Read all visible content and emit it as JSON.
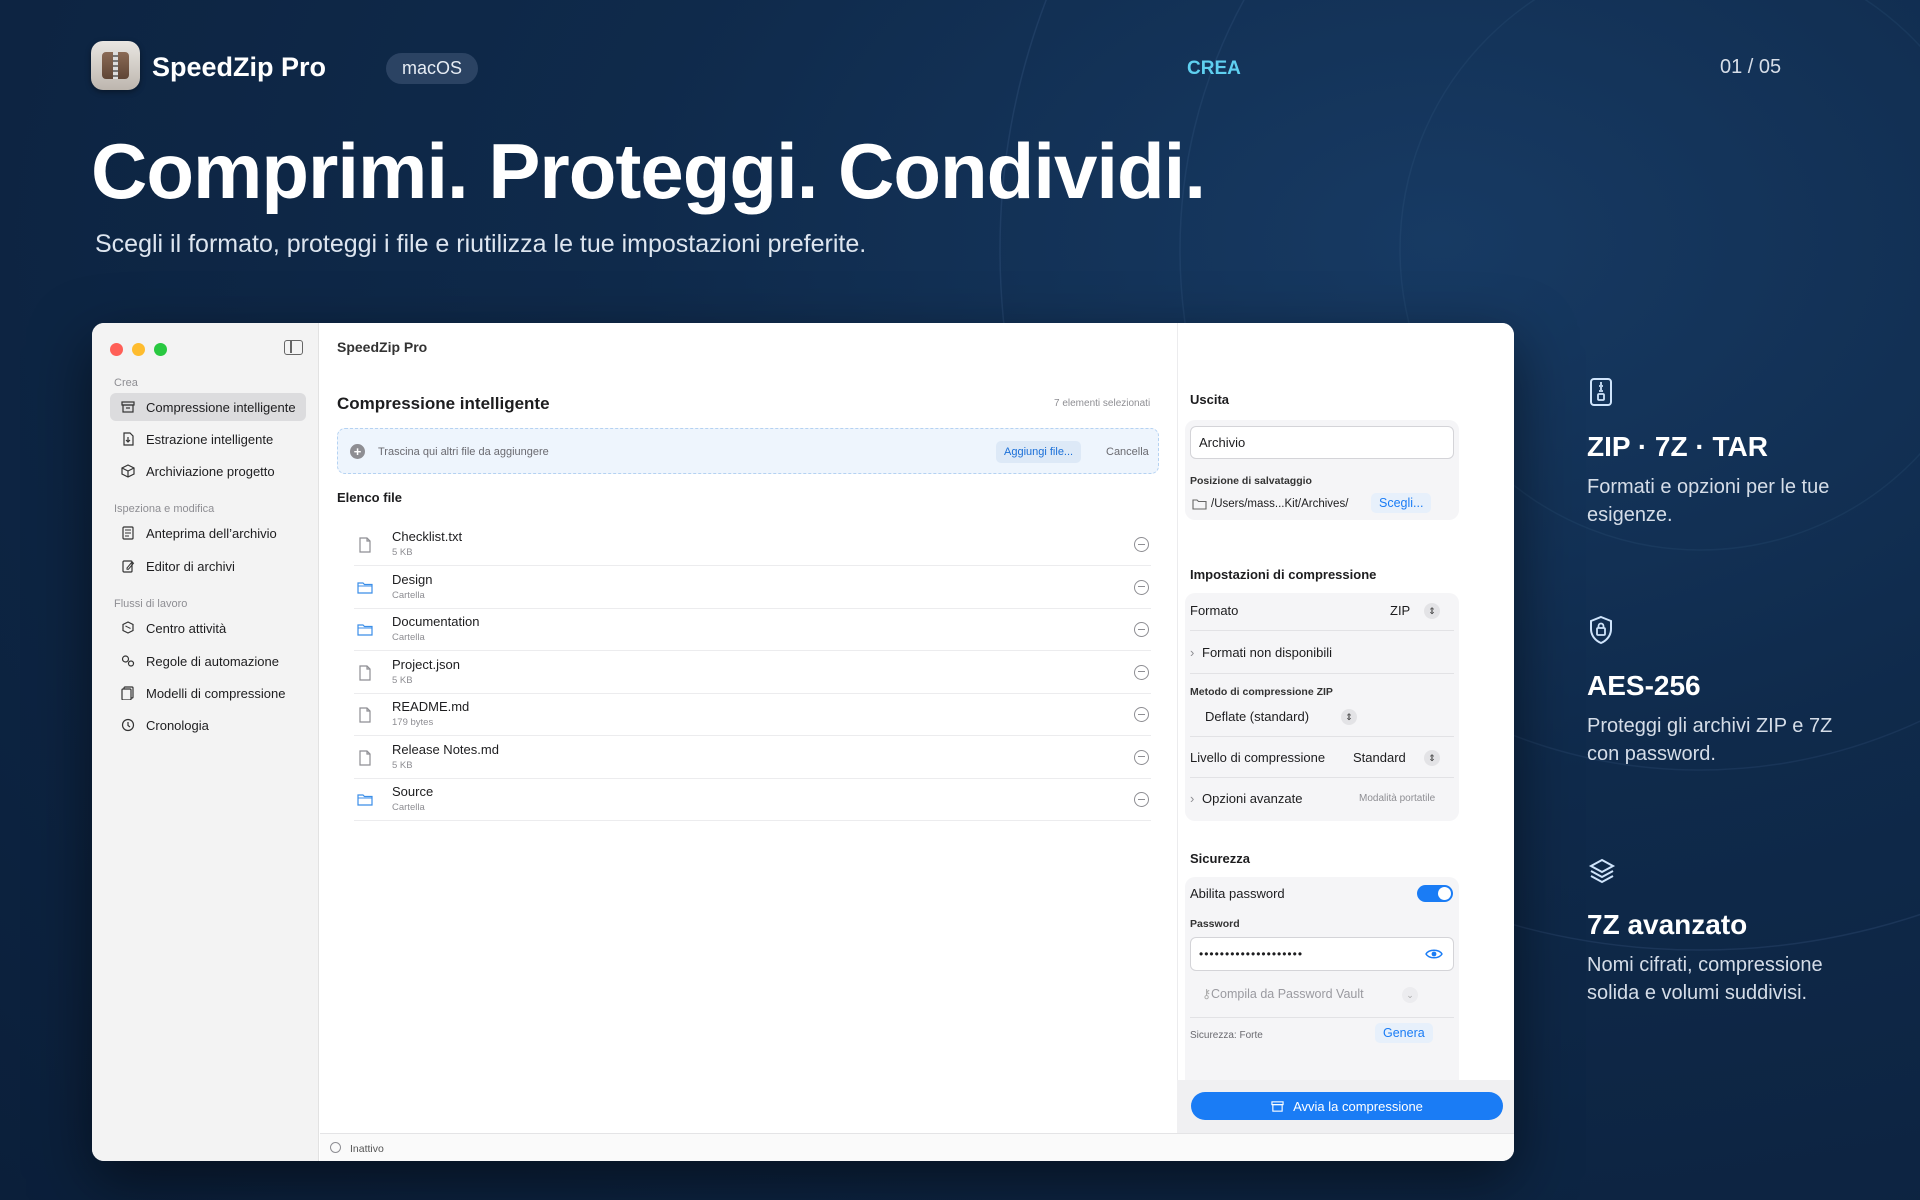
{
  "header": {
    "app_name": "SpeedZip Pro",
    "platform": "macOS",
    "section": "CREA",
    "page": "01 / 05",
    "headline": "Comprimi. Proteggi. Condividi.",
    "subline": "Scegli il formato, proteggi i file e riutilizza le tue impostazioni preferite."
  },
  "window": {
    "title": "SpeedZip Pro",
    "sidebar": {
      "group_create": "Crea",
      "group_inspect": "Ispeziona e modifica",
      "group_workflows": "Flussi di lavoro",
      "items": [
        {
          "label": "Compressione intelligente",
          "icon": "archive-icon"
        },
        {
          "label": "Estrazione intelligente",
          "icon": "extract-icon"
        },
        {
          "label": "Archiviazione progetto",
          "icon": "package-icon"
        },
        {
          "label": "Anteprima dell’archivio",
          "icon": "preview-icon"
        },
        {
          "label": "Editor di archivi",
          "icon": "edit-icon"
        },
        {
          "label": "Centro attività",
          "icon": "activity-icon"
        },
        {
          "label": "Regole di automazione",
          "icon": "automation-icon"
        },
        {
          "label": "Modelli di compressione",
          "icon": "template-icon"
        },
        {
          "label": "Cronologia",
          "icon": "clock-icon"
        }
      ]
    },
    "main": {
      "title": "Compressione intelligente",
      "selected_count": "7 elementi selezionati",
      "dropzone_text": "Trascina qui altri file da aggiungere",
      "add_files": "Aggiungi file...",
      "cancel": "Cancella",
      "list_title": "Elenco file",
      "files": [
        {
          "name": "Checklist.txt",
          "meta": "5 KB",
          "type": "file"
        },
        {
          "name": "Design",
          "meta": "Cartella",
          "type": "folder"
        },
        {
          "name": "Documentation",
          "meta": "Cartella",
          "type": "folder"
        },
        {
          "name": "Project.json",
          "meta": "5 KB",
          "type": "file"
        },
        {
          "name": "README.md",
          "meta": "179 bytes",
          "type": "file"
        },
        {
          "name": "Release Notes.md",
          "meta": "5 KB",
          "type": "file"
        },
        {
          "name": "Source",
          "meta": "Cartella",
          "type": "folder"
        }
      ]
    },
    "status": "Inattivo",
    "panel": {
      "output_title": "Uscita",
      "archive_name": "Archivio",
      "save_location_label": "Posizione di salvataggio",
      "save_path": "/Users/mass...Kit/Archives/",
      "choose": "Scegli...",
      "compression_title": "Impostazioni di compressione",
      "format_label": "Formato",
      "format_value": "ZIP",
      "unavailable_formats": "Formati non disponibili",
      "zip_method_label": "Metodo di compressione ZIP",
      "zip_method_value": "Deflate (standard)",
      "level_label": "Livello di compressione",
      "level_value": "Standard",
      "advanced_label": "Opzioni avanzate",
      "advanced_value": "Modalità portatile",
      "security_title": "Sicurezza",
      "enable_password": "Abilita password",
      "password_enabled": true,
      "password_label": "Password",
      "password_mask": "••••••••••••••••••••",
      "vault_label": "Compila da Password Vault",
      "strength": "Sicurezza: Forte",
      "generate": "Genera",
      "start_button": "Avvia la compressione"
    }
  },
  "features": [
    {
      "icon": "zip-file-icon",
      "title": "ZIP · 7Z · TAR",
      "desc": "Formati e opzioni per le tue esigenze."
    },
    {
      "icon": "lock-shield-icon",
      "title": "AES-256",
      "desc": "Proteggi gli archivi ZIP e 7Z con password."
    },
    {
      "icon": "layers-icon",
      "title": "7Z avanzato",
      "desc": "Nomi cifrati, compressione solida e volumi suddivisi."
    }
  ],
  "colors": {
    "accent": "#1a7cf5",
    "section_label": "#5fd0f0",
    "background": "#0f2a4b"
  }
}
